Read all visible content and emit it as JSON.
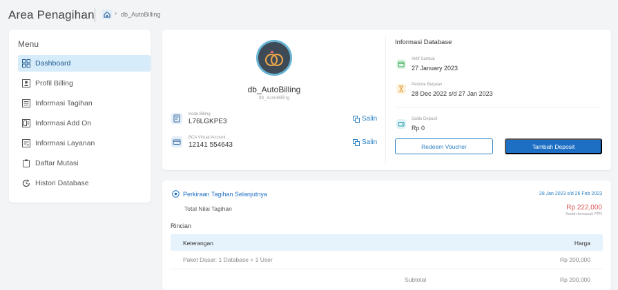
{
  "header": {
    "title": "Area Penagihan",
    "breadcrumb": "db_AutoBilling"
  },
  "menu": {
    "title": "Menu",
    "items": [
      {
        "label": "Dashboard",
        "icon": "dashboard-icon",
        "active": true
      },
      {
        "label": "Profil Billing",
        "icon": "profile-icon",
        "active": false
      },
      {
        "label": "Informasi Tagihan",
        "icon": "invoice-icon",
        "active": false
      },
      {
        "label": "Informasi Add On",
        "icon": "addon-icon",
        "active": false
      },
      {
        "label": "Informasi Layanan",
        "icon": "service-icon",
        "active": false
      },
      {
        "label": "Daftar Mutasi",
        "icon": "clipboard-icon",
        "active": false
      },
      {
        "label": "Histori Database",
        "icon": "history-icon",
        "active": false
      }
    ]
  },
  "database": {
    "name": "db_AutoBilling",
    "sub_name": "db_AutoBilling",
    "billing_code_label": "Kode Billing",
    "billing_code": "L76LGKPE3",
    "va_label": "BCA Virtual Account",
    "va_number": "12141 554643",
    "copy_label": "Salin"
  },
  "db_info": {
    "title": "Informasi Database",
    "active_until_label": "Aktif Sampai",
    "active_until": "27 January 2023",
    "period_label": "Periode Berjalan",
    "period": "28 Dec 2022 s/d 27 Jan 2023",
    "deposit_label": "Saldo Deposit",
    "deposit": "Rp 0",
    "redeem_button": "Redeem Voucher",
    "deposit_button": "Tambah Deposit"
  },
  "estimate": {
    "title": "Perkiraan Tagihan Selanjutnya",
    "period": "28 Jan 2023 s/d 26 Feb 2023",
    "total_label": "Total Nilai Tagihan",
    "total_value": "Rp 222,000",
    "total_note": "Sudah termasuk PPN",
    "details_label": "Rincian",
    "columns": [
      "Keterangan",
      "Harga"
    ],
    "rows": [
      {
        "desc": "Paket Dasar: 1 Database + 1 User",
        "price": "Rp 200,000"
      }
    ],
    "subtotal_label": "Subtotal",
    "subtotal_value": "Rp 200,000"
  },
  "colors": {
    "accent": "#1d6fc4",
    "active_bg": "#d7ecfa",
    "price_red": "#d9534f"
  }
}
